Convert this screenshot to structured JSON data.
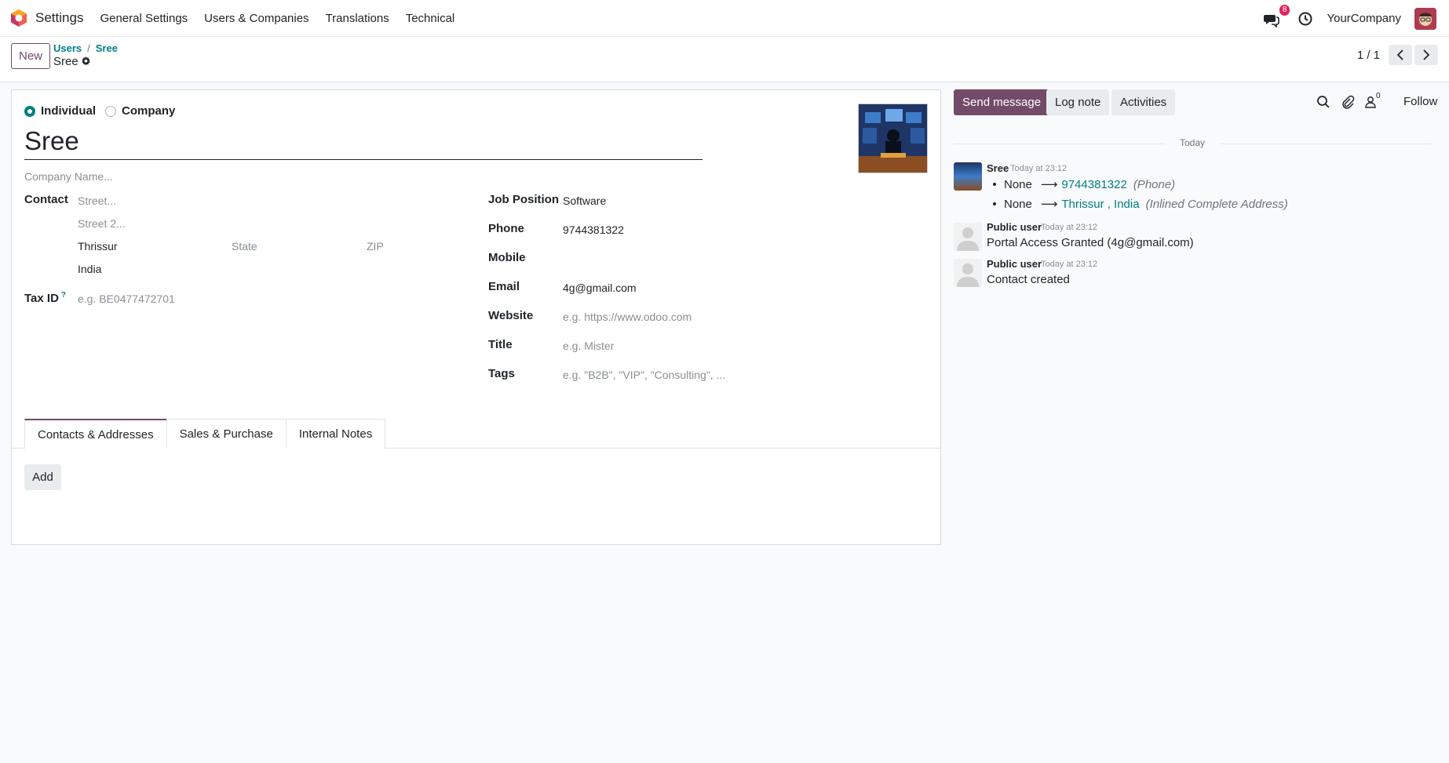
{
  "navbar": {
    "app_name": "Settings",
    "menus": [
      "General Settings",
      "Users & Companies",
      "Translations",
      "Technical"
    ],
    "message_count": "8",
    "company": "YourCompany"
  },
  "control": {
    "new_label": "New",
    "breadcrumb": [
      "Users",
      "Sree"
    ],
    "current": "Sree",
    "pager": "1 / 1"
  },
  "form": {
    "type_options": [
      "Individual",
      "Company"
    ],
    "selected_type": "Individual",
    "name": "Sree",
    "company_placeholder": "Company Name...",
    "contact_label": "Contact",
    "street_placeholder": "Street...",
    "street2_placeholder": "Street 2...",
    "city": "Thrissur",
    "state_placeholder": "State",
    "zip_placeholder": "ZIP",
    "country": "India",
    "tax_label": "Tax ID",
    "tax_help": "?",
    "tax_placeholder": "e.g. BE0477472701",
    "job_label": "Job Position",
    "job_value": "Software",
    "phone_label": "Phone",
    "phone_value": "9744381322",
    "mobile_label": "Mobile",
    "email_label": "Email",
    "email_value": "4g@gmail.com",
    "website_label": "Website",
    "website_placeholder": "e.g. https://www.odoo.com",
    "title_label": "Title",
    "title_placeholder": "e.g. Mister",
    "tags_label": "Tags",
    "tags_placeholder": "e.g. \"B2B\", \"VIP\", \"Consulting\", ...",
    "tabs": [
      "Contacts & Addresses",
      "Sales & Purchase",
      "Internal Notes"
    ],
    "active_tab": "Contacts & Addresses",
    "add_label": "Add"
  },
  "chatter": {
    "send_message": "Send message",
    "log_note": "Log note",
    "activities": "Activities",
    "follower_count": "0",
    "follow": "Follow",
    "date_separator": "Today",
    "messages": [
      {
        "author": "Sree",
        "time": "Today at 23:12",
        "changes": [
          {
            "old": "None",
            "new": "9744381322",
            "field": "(Phone)"
          },
          {
            "old": "None",
            "new": "Thrissur , India",
            "field": "(Inlined Complete Address)"
          }
        ]
      },
      {
        "author": "Public user",
        "time": "Today at 23:12",
        "body": "Portal Access Granted (4g@gmail.com)"
      },
      {
        "author": "Public user",
        "time": "Today at 23:12",
        "body": "Contact created"
      }
    ]
  },
  "colors": {
    "primary": "#714b67",
    "accent": "#017e84",
    "badge": "#e0245e"
  }
}
